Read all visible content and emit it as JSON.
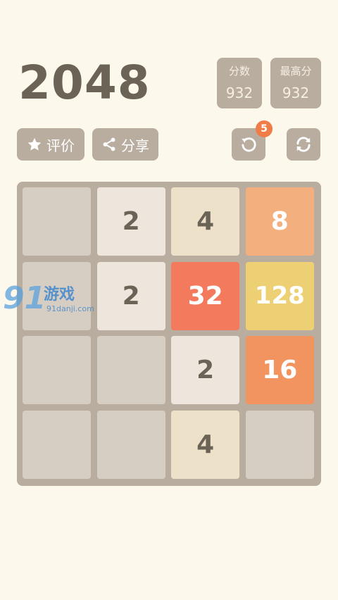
{
  "title": "2048",
  "score": {
    "label": "分数",
    "value": "932"
  },
  "best": {
    "label": "最高分",
    "value": "932"
  },
  "buttons": {
    "rate_label": "评价",
    "share_label": "分享",
    "undo_badge": "5"
  },
  "watermark": {
    "main": "游戏",
    "sub": "91danji.com"
  },
  "colors": {
    "background": "#fdf8ec",
    "board": "#b9ad9f",
    "empty_cell": "#d6cec3",
    "dark_text": "#6b6356",
    "light_text": "#ffffff",
    "badge": "#f07c48"
  },
  "tile_colors": {
    "2": {
      "bg": "#eee6dc",
      "fg": "#6b6356"
    },
    "4": {
      "bg": "#eee1ca",
      "fg": "#6b6356"
    },
    "8": {
      "bg": "#f3b07e",
      "fg": "#ffffff"
    },
    "16": {
      "bg": "#f2945f",
      "fg": "#ffffff"
    },
    "32": {
      "bg": "#f47a5e",
      "fg": "#ffffff"
    },
    "128": {
      "bg": "#ecd073",
      "fg": "#ffffff"
    }
  },
  "board": [
    [
      "",
      "2",
      "4",
      "8"
    ],
    [
      "",
      "2",
      "32",
      "128"
    ],
    [
      "",
      "",
      "2",
      "16"
    ],
    [
      "",
      "",
      "4",
      ""
    ]
  ]
}
